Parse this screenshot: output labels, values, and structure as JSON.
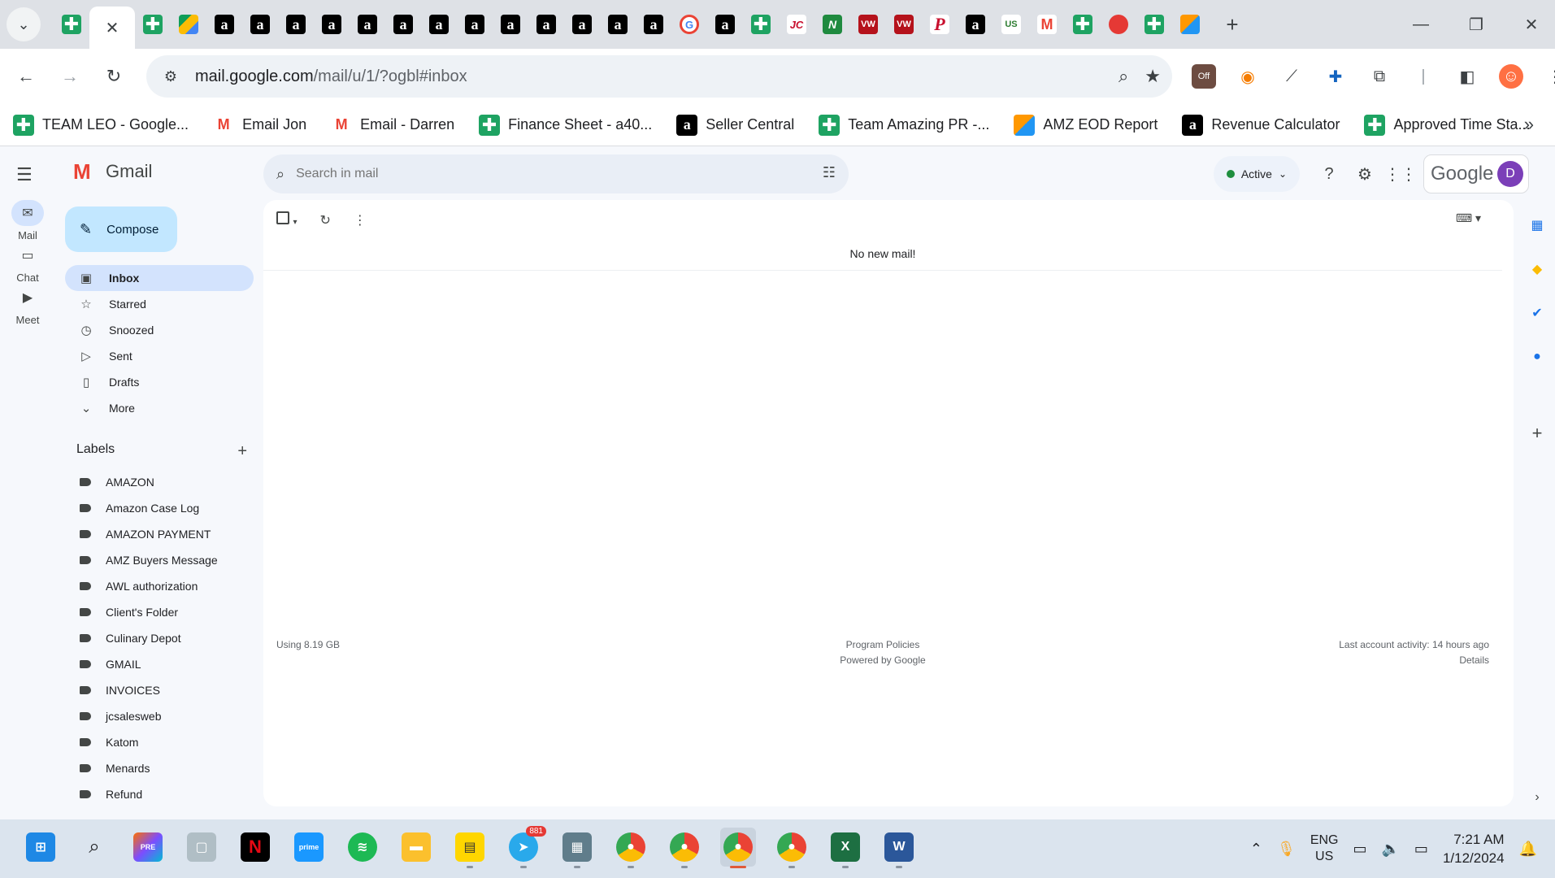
{
  "browser": {
    "tabs": [
      {
        "icon": "google-sheets-icon",
        "kind": "sheet"
      },
      {
        "icon": "close-icon",
        "kind": "active"
      },
      {
        "icon": "google-sheets-icon",
        "kind": "sheet"
      },
      {
        "icon": "google-drive-icon",
        "kind": "drive"
      },
      {
        "icon": "amazon-icon",
        "kind": "amz"
      },
      {
        "icon": "amazon-icon",
        "kind": "amz"
      },
      {
        "icon": "amazon-icon",
        "kind": "amz"
      },
      {
        "icon": "amazon-icon",
        "kind": "amz"
      },
      {
        "icon": "amazon-icon",
        "kind": "amz"
      },
      {
        "icon": "amazon-icon",
        "kind": "amz"
      },
      {
        "icon": "amazon-icon",
        "kind": "amz"
      },
      {
        "icon": "amazon-icon",
        "kind": "amz"
      },
      {
        "icon": "amazon-icon",
        "kind": "amz"
      },
      {
        "icon": "amazon-icon",
        "kind": "amz"
      },
      {
        "icon": "amazon-icon",
        "kind": "amz"
      },
      {
        "icon": "amazon-icon",
        "kind": "amz"
      },
      {
        "icon": "amazon-icon",
        "kind": "amz"
      },
      {
        "icon": "google-icon",
        "kind": "g"
      },
      {
        "icon": "amazon-icon",
        "kind": "amz"
      },
      {
        "icon": "google-sheets-icon",
        "kind": "sheet"
      },
      {
        "icon": "jc-icon",
        "kind": "jc"
      },
      {
        "icon": "n-icon",
        "kind": "n"
      },
      {
        "icon": "vw-icon",
        "kind": "red"
      },
      {
        "icon": "vw-icon",
        "kind": "red"
      },
      {
        "icon": "p-icon",
        "kind": "p"
      },
      {
        "icon": "amazon-icon",
        "kind": "amz"
      },
      {
        "icon": "us-foods-icon",
        "kind": "us"
      },
      {
        "icon": "gmail-icon",
        "kind": "gm"
      },
      {
        "icon": "google-sheets-icon",
        "kind": "sheet"
      },
      {
        "icon": "red-circle-icon",
        "kind": "cr"
      },
      {
        "icon": "google-sheets-icon",
        "kind": "sheet"
      },
      {
        "icon": "eod-icon",
        "kind": "eod"
      }
    ],
    "url_host": "mail.google.com",
    "url_path": "/mail/u/1/?ogbl#inbox",
    "bookmarks": [
      {
        "label": "TEAM LEO - Google...",
        "kind": "sheet"
      },
      {
        "label": "Email Jon",
        "kind": "gm"
      },
      {
        "label": "Email - Darren",
        "kind": "gm"
      },
      {
        "label": "Finance Sheet - a40...",
        "kind": "sheet"
      },
      {
        "label": "Seller Central",
        "kind": "amz"
      },
      {
        "label": "Team Amazing PR -...",
        "kind": "sheet"
      },
      {
        "label": "AMZ EOD Report",
        "kind": "eod"
      },
      {
        "label": "Revenue Calculator",
        "kind": "amz"
      },
      {
        "label": "Approved Time Sta...",
        "kind": "sheet"
      }
    ]
  },
  "gmail": {
    "brand": "Gmail",
    "rail": [
      {
        "label": "Mail",
        "icon": "mail-icon",
        "active": true
      },
      {
        "label": "Chat",
        "icon": "chat-icon",
        "active": false
      },
      {
        "label": "Meet",
        "icon": "meet-icon",
        "active": false
      }
    ],
    "compose_label": "Compose",
    "nav": [
      {
        "label": "Inbox",
        "icon": "inbox-icon",
        "glyph": "▣",
        "active": true
      },
      {
        "label": "Starred",
        "icon": "star-icon",
        "glyph": "☆",
        "active": false
      },
      {
        "label": "Snoozed",
        "icon": "clock-icon",
        "glyph": "◷",
        "active": false
      },
      {
        "label": "Sent",
        "icon": "send-icon",
        "glyph": "▷",
        "active": false
      },
      {
        "label": "Drafts",
        "icon": "draft-icon",
        "glyph": "▯",
        "active": false
      },
      {
        "label": "More",
        "icon": "chevron-down-icon",
        "glyph": "⌄",
        "active": false
      }
    ],
    "labels_heading": "Labels",
    "labels": [
      "AMAZON",
      "Amazon Case Log",
      "AMAZON PAYMENT",
      "AMZ Buyers Message",
      "AWL authorization",
      "Client's Folder",
      "Culinary Depot",
      "GMAIL",
      "INVOICES",
      "jcsalesweb",
      "Katom",
      "Menards",
      "Refund"
    ],
    "search_placeholder": "Search in mail",
    "status_label": "Active",
    "account_brand": "Google",
    "avatar_letter": "D",
    "empty_message": "No new mail!",
    "storage": "Using 8.19 GB",
    "program_policies": "Program Policies",
    "powered_by": "Powered by Google",
    "last_activity": "Last account activity: 14 hours ago",
    "details": "Details"
  },
  "taskbar": {
    "telegram_badge": "881",
    "lang_line1": "ENG",
    "lang_line2": "US",
    "time": "7:21 AM",
    "date": "1/12/2024"
  }
}
